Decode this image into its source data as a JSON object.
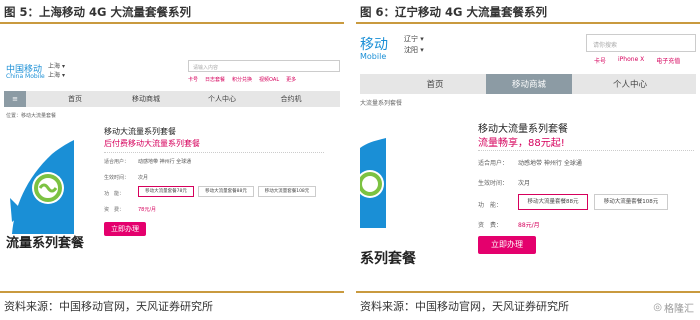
{
  "fig5": {
    "title": "图 5：上海移动 4G 大流量套餐系列",
    "source": "资料来源：中国移动官网，天风证券研究所",
    "logo_cn": "中国移动",
    "logo_en": "China Mobile",
    "province": "上海",
    "province_sub": "上海",
    "search_placeholder": "请输入内容",
    "links": [
      "卡号",
      "日志套餐",
      "积分兑换",
      "视频OAL",
      "更多"
    ],
    "nav": [
      "首页",
      "移动商城",
      "个人中心",
      "合约机"
    ],
    "breadcrumb": "位置：移动大流量套餐",
    "product_name": "移动大流量系列套餐",
    "tagline": "后付费移动大流量系列套餐",
    "rows": {
      "users_label": "适合用户：",
      "users_value": "动感地带  神州行  全球通",
      "effective_label": "生效时间：",
      "effective_value": "次月",
      "function_label": "功　能：",
      "options": [
        "移动大流量套餐78元",
        "移动大流量套餐88元",
        "移动大流量套餐108元"
      ],
      "fee_label": "资　费：",
      "fee_value": "78元/月"
    },
    "buy_label": "立即办理",
    "banner_text": "流量系列套餐"
  },
  "fig6": {
    "title": "图 6：辽宁移动 4G 大流量套餐系列",
    "source": "资料来源：中国移动官网，天风证券研究所",
    "logo_cn": "移动",
    "logo_en": "Mobile",
    "province": "辽宁",
    "province_sub": "沈阳",
    "search_placeholder": "请你搜索",
    "links": [
      "卡号",
      "iPhone X",
      "电子充值"
    ],
    "nav": [
      "首页",
      "移动商城",
      "个人中心"
    ],
    "breadcrumb": "大流量系列套餐",
    "product_name": "移动大流量系列套餐",
    "tagline": "流量畅享，88元起!",
    "rows": {
      "users_label": "适合用户：",
      "users_value": "动感地带  神州行  全球通",
      "effective_label": "生效时间：",
      "effective_value": "次月",
      "function_label": "功　能：",
      "options": [
        "移动大流量套餐88元",
        "移动大流量套餐108元"
      ],
      "fee_label": "资　费：",
      "fee_value": "88元/月"
    },
    "buy_label": "立即办理",
    "banner_text": "系列套餐"
  },
  "watermark": "格隆汇",
  "colors": {
    "accent_magenta": "#e4006d",
    "brand_blue": "#1a8fd6",
    "rule_gold": "#c99a3f",
    "nav_active": "#8c9ba4",
    "rocket_green": "#7cc242"
  }
}
